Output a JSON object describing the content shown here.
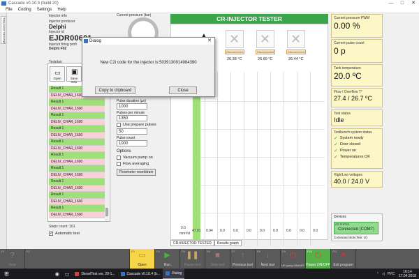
{
  "window": {
    "title": "Cascade v0.10.4 (build 20)",
    "controls": [
      "—",
      "□",
      "✕"
    ]
  },
  "menu": [
    "File",
    "Coding",
    "Settings",
    "Help"
  ],
  "side_tab": "MANUAL CONTROL",
  "injector_info": {
    "heading": "Injector info",
    "producer_label": "Injector producer",
    "producer": "Delphi",
    "id_label": "Injector id",
    "id": "EJDR00601",
    "firing_label": "Injector firing profi",
    "firing_value": "Delphi F02"
  },
  "testplan": {
    "heading": "Testplan",
    "open_label": "Open",
    "save_label": "Save resu",
    "rows": [
      {
        "text": "Result 1",
        "color": "green"
      },
      {
        "text": "DELIV_CHAR_1600",
        "color": "pink"
      },
      {
        "text": "Result 1",
        "color": "green"
      },
      {
        "text": "DELIV_CHAR_1600",
        "color": "pink"
      },
      {
        "text": "Result 1",
        "color": "green"
      },
      {
        "text": "DELIV_CHAR_1600",
        "color": "pink"
      },
      {
        "text": "Result 1",
        "color": "green"
      },
      {
        "text": "DELIV_CHAR_1600",
        "color": "pink"
      },
      {
        "text": "Result 1",
        "color": "green"
      },
      {
        "text": "DELIV_CHAR_1600",
        "color": "pink"
      },
      {
        "text": "Result 1",
        "color": "green"
      },
      {
        "text": "DELIV_CHAR_1600",
        "color": "pink"
      },
      {
        "text": "Result 1",
        "color": "green"
      },
      {
        "text": "DELIV_CHAR_1600",
        "color": "pink"
      },
      {
        "text": "Result 1",
        "color": "green"
      },
      {
        "text": "DELIV_CHAR_1600",
        "color": "pink"
      },
      {
        "text": "Result 1",
        "color": "green"
      },
      {
        "text": "DELIV_CHAR_1600",
        "color": "pink"
      },
      {
        "text": "Result 1",
        "color": "green"
      },
      {
        "text": "DELIV_CHAR_1600",
        "color": "pink"
      }
    ],
    "steps_count": "Steps count: 161",
    "auto_test": "Automatic test"
  },
  "gauge": {
    "label": "Current pressure (bar)"
  },
  "params": {
    "duration_label": "Pulse duration (µs)",
    "duration": "1000",
    "ppm_label": "Pulses per minute",
    "ppm": "1350",
    "prepare_label": "Use prepare pulses",
    "prepare_value": "50",
    "count_label": "Pulse count",
    "count": "1000",
    "options_heading": "Options",
    "vacuum": "Vacuum pump on",
    "flow_avg": "Flow averaging",
    "flowmeter_btn": "Flowmeter reset/drain"
  },
  "main": {
    "title": "CR-INJECTOR TESTER",
    "channels": [
      {
        "temp": "26.38 °C",
        "status": "Disconnected"
      },
      {
        "temp": "26.69 °C",
        "status": "Disconnected"
      },
      {
        "temp": "26.44 °C",
        "status": "Disconnected"
      }
    ],
    "y_zero": "0.0",
    "y_unit": "mm³/st",
    "x_ticks": [
      "47.01",
      "0.04",
      "0.0",
      "0.0",
      "0.0",
      "0.0",
      "0.0",
      "0.0",
      "0.0",
      "0.0"
    ],
    "tabs": [
      "CR-INJECTOR TESTER",
      "Results graph"
    ]
  },
  "right": {
    "pwm_label": "Current pressure PWM",
    "pwm": "0.00 %",
    "pulse_label": "Current pulse count",
    "pulse": "0 p",
    "tank_label": "Tank temperature",
    "tank": "20.0 ºC",
    "flow_label": "Flow / Overflow T°",
    "flow": "27.4 / 26.7 ºC",
    "test_status_label": "Test status",
    "test_status": "Idle",
    "system_label": "Testbench system status",
    "system_items": [
      "System ready",
      "Door closed",
      "Power on",
      "Temperatures OK"
    ],
    "voltage_label": "High/Low voltages",
    "voltage": "40.0 / 24.0 V",
    "devices_label": "Devices",
    "device_name": "CR-TESTER",
    "device_status": "Connected (COM7)",
    "slots": "Command slots free: 10"
  },
  "fkeys": [
    {
      "key": "F1",
      "icon": "?",
      "label": "Help",
      "style": "dim"
    },
    {
      "key": "F2",
      "icon": "",
      "label": "",
      "style": "dim"
    },
    {
      "key": "F3",
      "icon": "▭",
      "label": "Open",
      "style": "active"
    },
    {
      "key": "F4",
      "icon": "▶",
      "label": "Run",
      "style": ""
    },
    {
      "key": "F5",
      "icon": "❚❚",
      "label": "Pause test",
      "style": "dim"
    },
    {
      "key": "F6",
      "icon": "■",
      "label": "Stop test",
      "style": "dim"
    },
    {
      "key": "F7",
      "icon": "↑",
      "label": "Previous test",
      "style": ""
    },
    {
      "key": "F8",
      "icon": "↓",
      "label": "Next test",
      "style": ""
    },
    {
      "key": "F9",
      "icon": "⏻",
      "label": "HP pump ON/OFF",
      "style": ""
    },
    {
      "key": "F10",
      "icon": "⏻",
      "label": "Power ON/OFF",
      "style": "green"
    },
    {
      "key": "F11",
      "icon": "✕",
      "label": "Exit program",
      "style": ""
    }
  ],
  "dialog": {
    "title": "Dialog",
    "message": "New C2i code for the injector is:5039130914984380",
    "copy_label": "Copy to clipboard",
    "close_label": "Close"
  },
  "taskbar": {
    "items": [
      "DieselTest ver. 20-1...",
      "Cascade v0.10.4 (b...",
      "Dialog"
    ],
    "lang": "РУС",
    "time": "16:14",
    "date": "17.04.2018"
  },
  "colors": {
    "accent_green": "#3aa64a",
    "result_green": "#9fe07a",
    "fail_pink": "#f8d0d8",
    "panel_yellow": "#fdf7c7"
  }
}
